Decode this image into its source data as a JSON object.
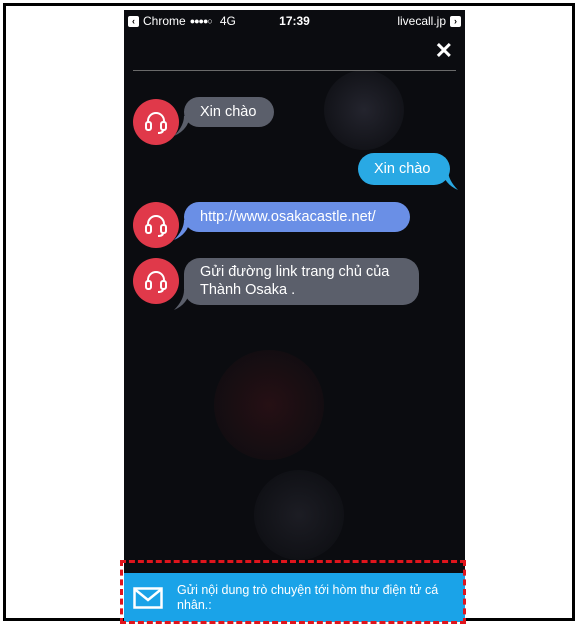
{
  "status_bar": {
    "back_app": "Chrome",
    "signal": "●●●●○",
    "network": "4G",
    "time": "17:39",
    "site": "livecall.jp"
  },
  "close_icon": "close-icon",
  "messages": [
    {
      "sender": "agent",
      "text": "Xin chào"
    },
    {
      "sender": "user",
      "text": "Xin chào"
    },
    {
      "sender": "agent",
      "text": "http://www.osakacastle.net/"
    },
    {
      "sender": "agent",
      "text": "Gửi đường link trang chủ của Thành Osaka ."
    }
  ],
  "bottom_bar": {
    "label": "Gửi nội dung trò chuyện tới hòm thư điện tử cá nhân.:",
    "icon": "mail-icon"
  },
  "colors": {
    "agent_avatar": "#e0394a",
    "agent_bubble": "#5b5f6b",
    "link_bubble": "#6a8fe6",
    "user_bubble": "#29a9e4",
    "bottom_bar": "#1aa3e8",
    "highlight_border": "#e0141c"
  }
}
